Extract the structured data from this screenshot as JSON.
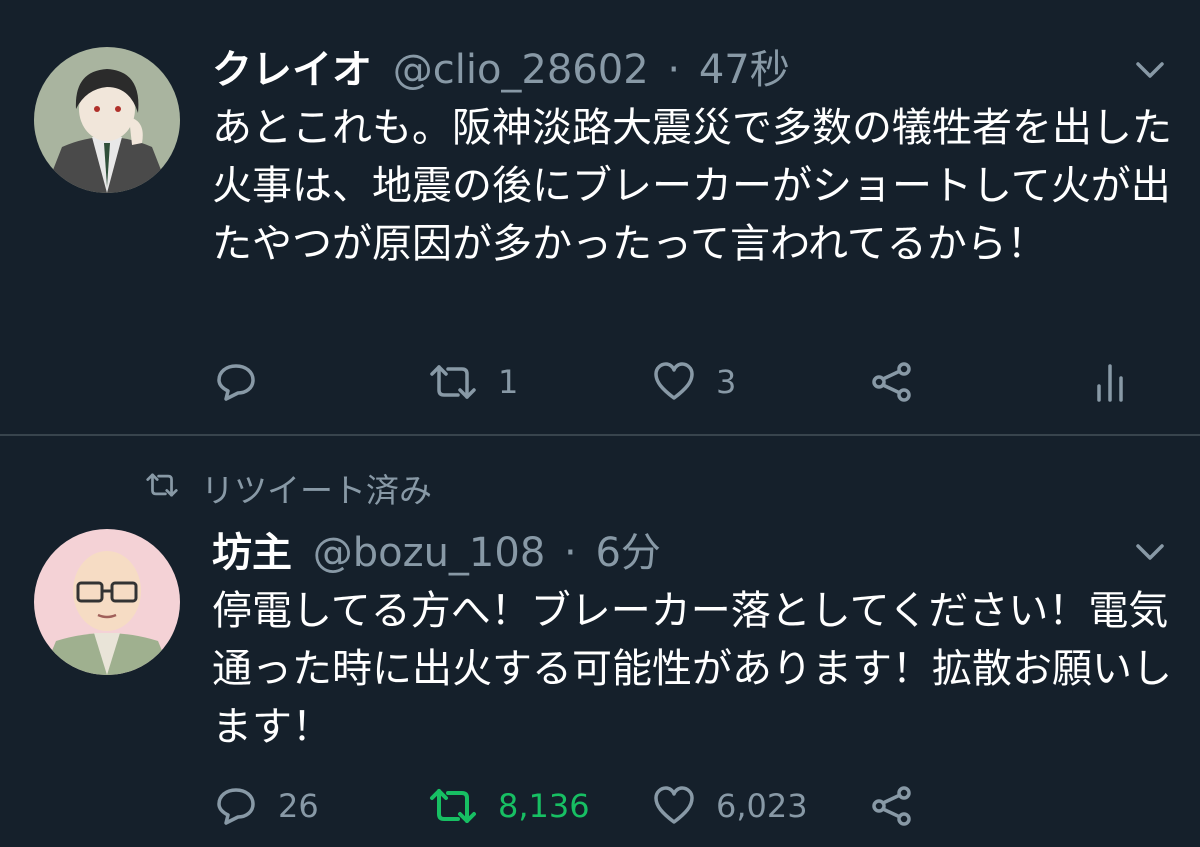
{
  "tweets": [
    {
      "author_name": "クレイオ",
      "handle": "@clio_28602",
      "separator": "·",
      "time": "47秒",
      "text": "あとこれも。阪神淡路大震災で多数の犠牲者を出した火事は、地震の後にブレーカーがショートして火が出たやつが原因が多かったって言われてるから！",
      "reply_count": "",
      "retweet_count": "1",
      "like_count": "3",
      "retweeted": false
    },
    {
      "retweet_context": "リツイート済み",
      "author_name": "坊主",
      "handle": "@bozu_108",
      "separator": "·",
      "time": "6分",
      "text": "停電してる方へ！ブレーカー落としてください！電気通った時に出火する可能性があります！拡散お願いします！",
      "reply_count": "26",
      "retweet_count": "8,136",
      "like_count": "6,023",
      "retweeted": true
    }
  ],
  "icons": {
    "reply": "reply-bubble-icon",
    "retweet": "retweet-arrows-icon",
    "like": "heart-icon",
    "share": "share-icon",
    "analytics": "analytics-bars-icon",
    "more": "chevron-down-icon"
  },
  "colors": {
    "background": "#15202b",
    "secondary_text": "#8899a6",
    "retweet_active": "#17bf63",
    "divider": "#38444d"
  }
}
